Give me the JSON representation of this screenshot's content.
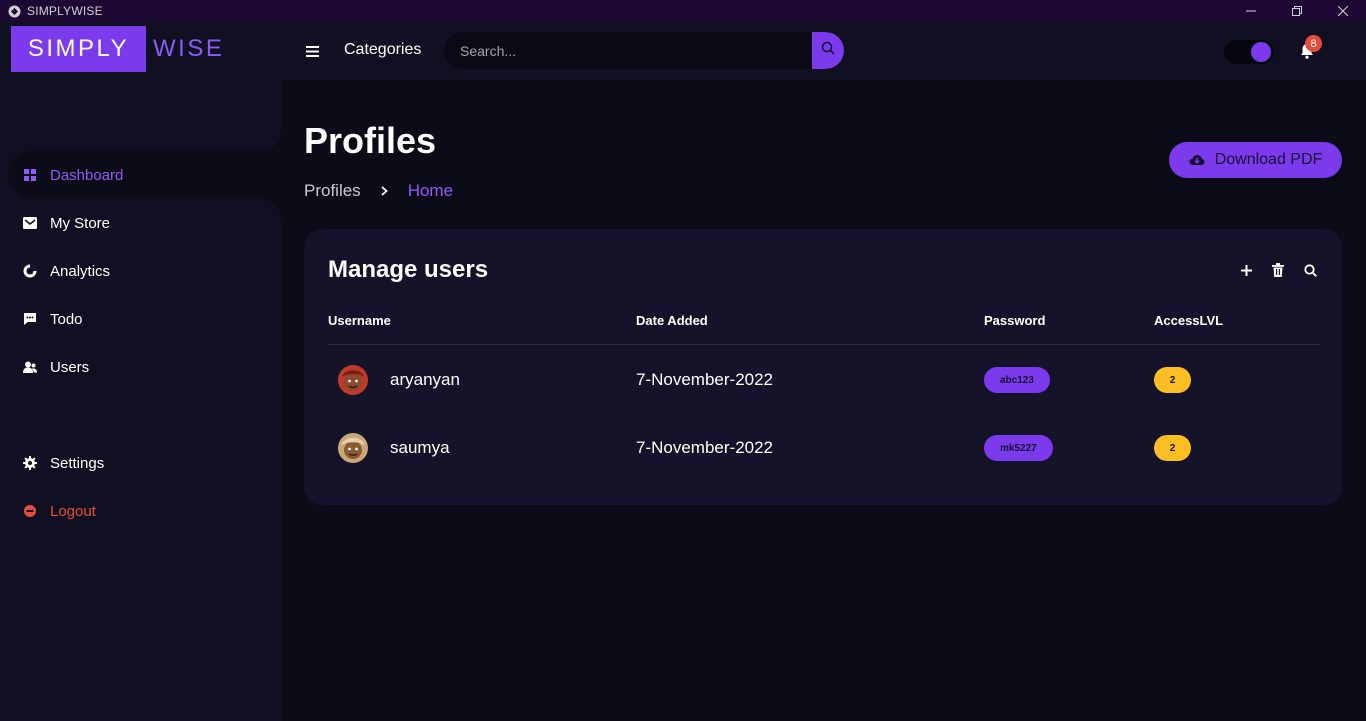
{
  "window": {
    "title": "SIMPLYWISE",
    "icon": "app-icon",
    "controls": [
      "minimize-icon",
      "restore-icon",
      "close-icon"
    ]
  },
  "topbar": {
    "logo_left": "SIMPLY",
    "logo_right": "WISE",
    "categories_label": "Categories",
    "search_placeholder": "Search...",
    "notification_count": "8",
    "theme_toggle_on": true
  },
  "sidebar": {
    "items": [
      {
        "label": "Dashboard",
        "icon": "grid-icon",
        "active": true
      },
      {
        "label": "My Store",
        "icon": "store-icon"
      },
      {
        "label": "Analytics",
        "icon": "pie-chart-icon"
      },
      {
        "label": "Todo",
        "icon": "message-icon"
      },
      {
        "label": "Users",
        "icon": "users-icon"
      }
    ],
    "bottom_items": [
      {
        "label": "Settings",
        "icon": "gear-icon"
      },
      {
        "label": "Logout",
        "icon": "logout-icon"
      }
    ]
  },
  "main": {
    "title": "Profiles",
    "breadcrumb": [
      "Profiles",
      "Home"
    ],
    "download_label": "Download PDF"
  },
  "card": {
    "title": "Manage users",
    "actions": [
      "plus-icon",
      "trash-icon",
      "search-icon"
    ],
    "columns": [
      "Username",
      "Date Added",
      "Password",
      "AccessLVL"
    ],
    "rows": [
      {
        "username": "aryanyan",
        "date": "7-November-2022",
        "password": "abc123",
        "access": "2"
      },
      {
        "username": "saumya",
        "date": "7-November-2022",
        "password": "mk5227",
        "access": "2"
      }
    ]
  },
  "colors": {
    "accent": "#7c3aed",
    "accent_light": "#8b5cf6",
    "background": "#0c0b18",
    "panel": "#110f22",
    "card": "#15132a",
    "logout": "#e74c3c",
    "access_badge": "#fbbf24"
  }
}
